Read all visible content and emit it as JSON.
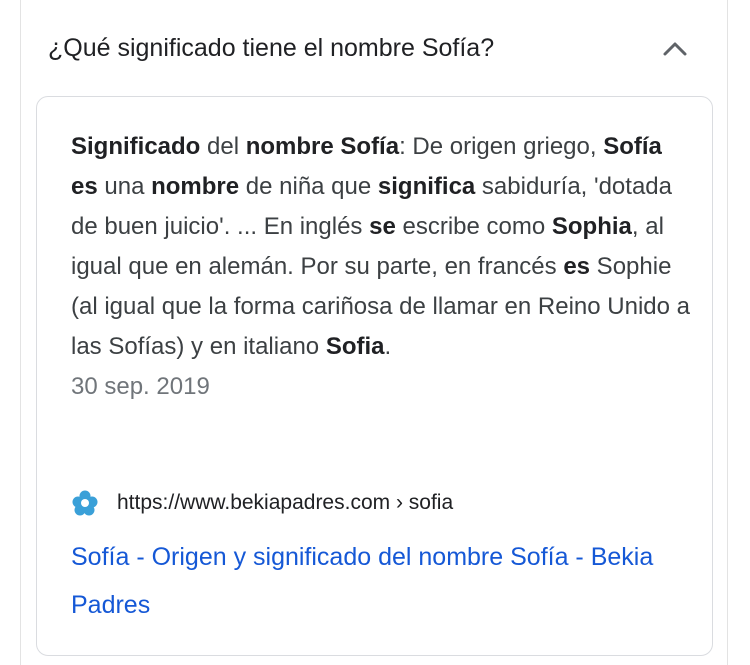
{
  "question": "¿Qué significado tiene el nombre Sofía?",
  "snippet": {
    "parts": [
      {
        "t": "Significado",
        "b": true
      },
      {
        "t": " del ",
        "b": false
      },
      {
        "t": "nombre Sofía",
        "b": true
      },
      {
        "t": ": De origen griego, ",
        "b": false
      },
      {
        "t": "Sofía es",
        "b": true
      },
      {
        "t": " una ",
        "b": false
      },
      {
        "t": "nombre",
        "b": true
      },
      {
        "t": " de niña que ",
        "b": false
      },
      {
        "t": "significa",
        "b": true
      },
      {
        "t": " sabiduría, 'dotada de buen juicio'. ... En inglés ",
        "b": false
      },
      {
        "t": "se",
        "b": true
      },
      {
        "t": " escribe como ",
        "b": false
      },
      {
        "t": "Sophia",
        "b": true
      },
      {
        "t": ", al igual que en alemán. Por su parte, en francés ",
        "b": false
      },
      {
        "t": "es",
        "b": true
      },
      {
        "t": " Sophie (al igual que la forma cariñosa de llamar en Reino Unido a las Sofías) y en italiano ",
        "b": false
      },
      {
        "t": "Sofia",
        "b": true
      },
      {
        "t": ".",
        "b": false
      }
    ],
    "date": "30 sep. 2019"
  },
  "source": {
    "url": "https://www.bekiapadres.com › sofia",
    "title": "Sofía - Origen y significado del nombre Sofía - Bekia Padres",
    "favicon_color": "#3aa0d8"
  },
  "icons": {
    "collapse": "chevron-up-icon",
    "site": "bekia-favicon-icon"
  }
}
